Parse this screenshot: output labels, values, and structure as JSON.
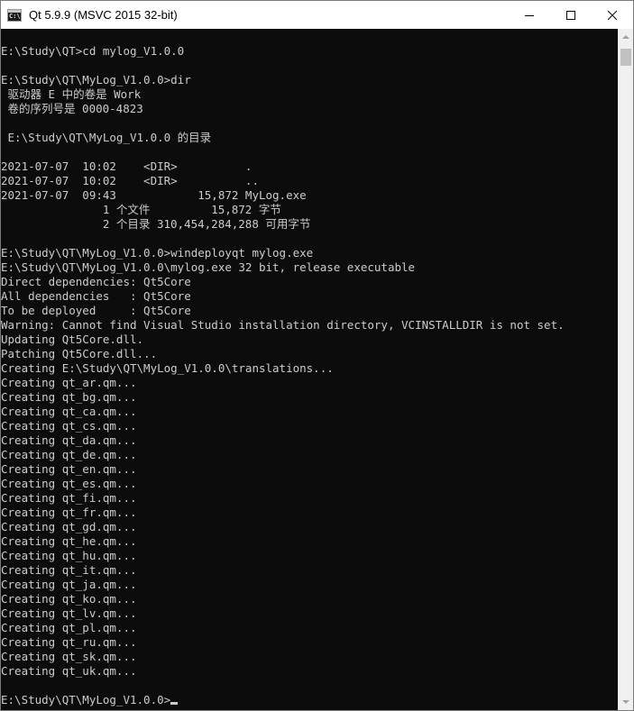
{
  "window": {
    "title": "Qt 5.9.9 (MSVC 2015 32-bit)",
    "app_icon_text": "C:\\",
    "controls": {
      "minimize_icon": "minimize-icon",
      "maximize_icon": "maximize-icon",
      "close_icon": "close-icon"
    }
  },
  "console": {
    "background": "#0c0c0c",
    "foreground": "#cccccc",
    "lines": [
      "E:\\Study\\QT>cd mylog_V1.0.0",
      "",
      "E:\\Study\\QT\\MyLog_V1.0.0>dir",
      " 驱动器 E 中的卷是 Work",
      " 卷的序列号是 0000-4823",
      "",
      " E:\\Study\\QT\\MyLog_V1.0.0 的目录",
      "",
      "2021-07-07  10:02    <DIR>          .",
      "2021-07-07  10:02    <DIR>          ..",
      "2021-07-07  09:43            15,872 MyLog.exe",
      "               1 个文件         15,872 字节",
      "               2 个目录 310,454,284,288 可用字节",
      "",
      "E:\\Study\\QT\\MyLog_V1.0.0>windeployqt mylog.exe",
      "E:\\Study\\QT\\MyLog_V1.0.0\\mylog.exe 32 bit, release executable",
      "Direct dependencies: Qt5Core",
      "All dependencies   : Qt5Core",
      "To be deployed     : Qt5Core",
      "Warning: Cannot find Visual Studio installation directory, VCINSTALLDIR is not set.",
      "Updating Qt5Core.dll.",
      "Patching Qt5Core.dll...",
      "Creating E:\\Study\\QT\\MyLog_V1.0.0\\translations...",
      "Creating qt_ar.qm...",
      "Creating qt_bg.qm...",
      "Creating qt_ca.qm...",
      "Creating qt_cs.qm...",
      "Creating qt_da.qm...",
      "Creating qt_de.qm...",
      "Creating qt_en.qm...",
      "Creating qt_es.qm...",
      "Creating qt_fi.qm...",
      "Creating qt_fr.qm...",
      "Creating qt_gd.qm...",
      "Creating qt_he.qm...",
      "Creating qt_hu.qm...",
      "Creating qt_it.qm...",
      "Creating qt_ja.qm...",
      "Creating qt_ko.qm...",
      "Creating qt_lv.qm...",
      "Creating qt_pl.qm...",
      "Creating qt_ru.qm...",
      "Creating qt_sk.qm...",
      "Creating qt_uk.qm...",
      ""
    ],
    "prompt": "E:\\Study\\QT\\MyLog_V1.0.0>"
  },
  "scrollbar": {
    "up_icon": "scroll-up-arrow-icon",
    "down_icon": "scroll-down-arrow-icon"
  }
}
